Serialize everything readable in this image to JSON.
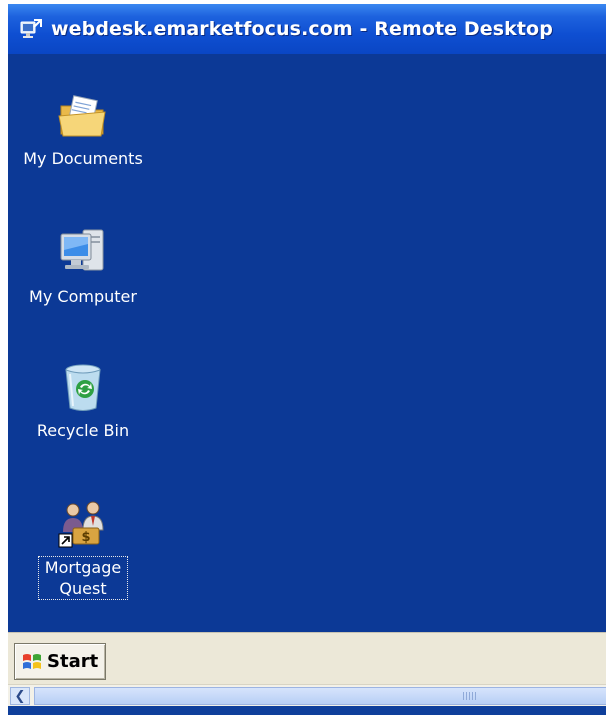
{
  "window": {
    "title": "webdesk.emarketfocus.com - Remote Desktop",
    "titlebar_color": "#0a46c4",
    "desktop_color": "#0c3996"
  },
  "desktop": {
    "icons": [
      {
        "label": "My Documents",
        "icon": "folder-documents-icon",
        "selected": false
      },
      {
        "label": "My Computer",
        "icon": "computer-icon",
        "selected": false
      },
      {
        "label": "Recycle Bin",
        "icon": "recycle-bin-icon",
        "selected": false
      },
      {
        "label": "Mortgage Quest",
        "icon": "mortgage-quest-shortcut-icon",
        "selected": true
      }
    ]
  },
  "taskbar": {
    "start_label": "Start",
    "start_icon": "windows-flag-icon",
    "color": "#ece8d8"
  },
  "scrollbar": {
    "left_arrow_icon": "scroll-left-arrow-icon"
  }
}
